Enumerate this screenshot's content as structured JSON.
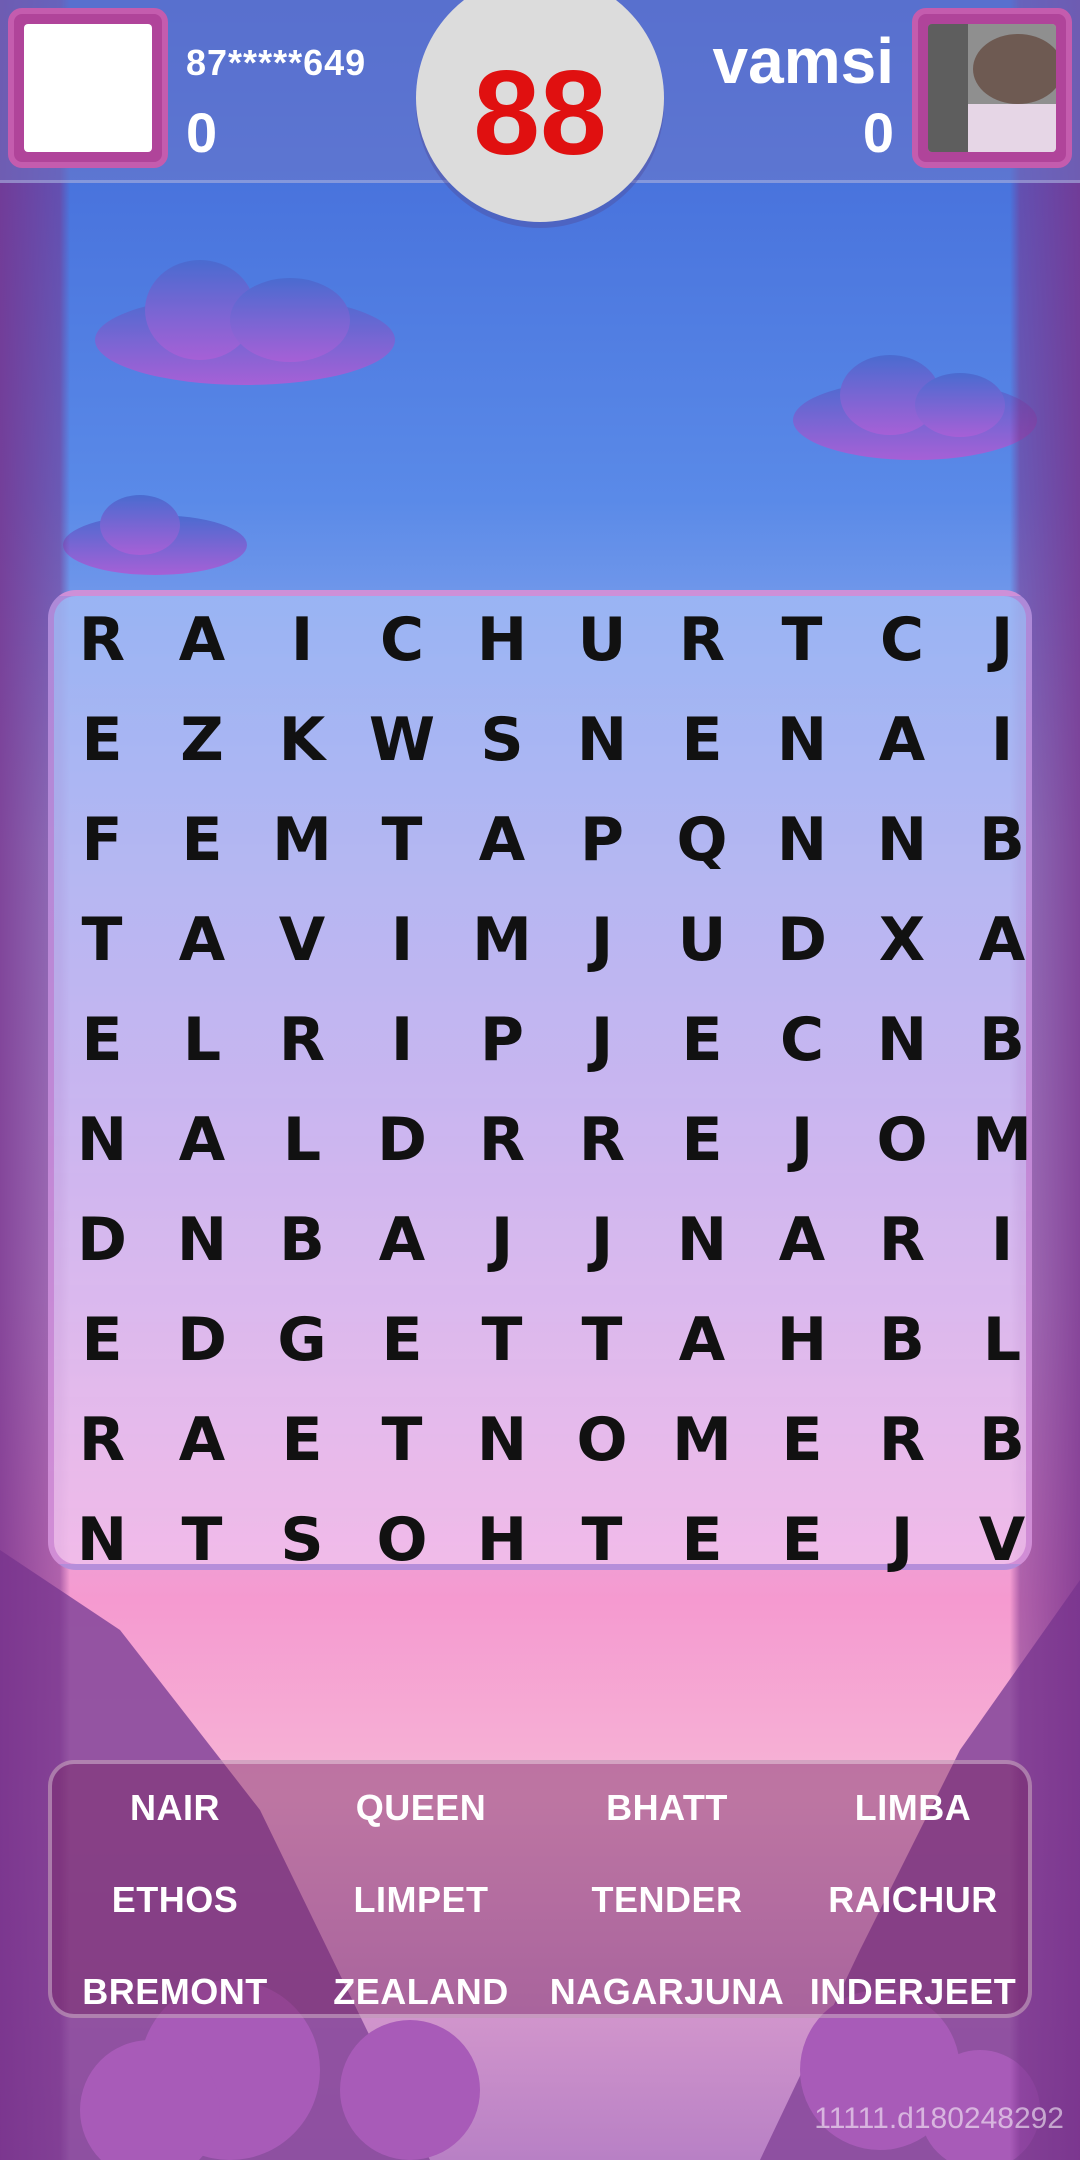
{
  "players": {
    "left": {
      "id": "87*****649",
      "score": "0"
    },
    "right": {
      "name": "vamsi",
      "score": "0"
    }
  },
  "timer": "88",
  "grid": [
    [
      "R",
      "A",
      "I",
      "C",
      "H",
      "U",
      "R",
      "T",
      "C",
      "J"
    ],
    [
      "E",
      "Z",
      "K",
      "W",
      "S",
      "N",
      "E",
      "N",
      "A",
      "I"
    ],
    [
      "F",
      "E",
      "M",
      "T",
      "A",
      "P",
      "Q",
      "N",
      "N",
      "B"
    ],
    [
      "T",
      "A",
      "V",
      "I",
      "M",
      "J",
      "U",
      "D",
      "X",
      "A"
    ],
    [
      "E",
      "L",
      "R",
      "I",
      "P",
      "J",
      "E",
      "C",
      "N",
      "B"
    ],
    [
      "N",
      "A",
      "L",
      "D",
      "R",
      "R",
      "E",
      "J",
      "O",
      "M"
    ],
    [
      "D",
      "N",
      "B",
      "A",
      "J",
      "J",
      "N",
      "A",
      "R",
      "I"
    ],
    [
      "E",
      "D",
      "G",
      "E",
      "T",
      "T",
      "A",
      "H",
      "B",
      "L"
    ],
    [
      "R",
      "A",
      "E",
      "T",
      "N",
      "O",
      "M",
      "E",
      "R",
      "B"
    ],
    [
      "N",
      "T",
      "S",
      "O",
      "H",
      "T",
      "E",
      "E",
      "J",
      "V"
    ]
  ],
  "words": [
    [
      "NAIR",
      "QUEEN",
      "BHATT",
      "LIMBA"
    ],
    [
      "ETHOS",
      "LIMPET",
      "TENDER",
      "RAICHUR"
    ],
    [
      "BREMONT",
      "ZEALAND",
      "NAGARJUNA",
      "INDERJEET"
    ]
  ],
  "build_id": "11111.d180248292",
  "colors": {
    "timer_text": "#e01010",
    "avatar_frame": "#b0449a"
  },
  "icons": {
    "left_avatar": "blank-avatar-icon",
    "right_avatar": "user-photo-avatar"
  }
}
